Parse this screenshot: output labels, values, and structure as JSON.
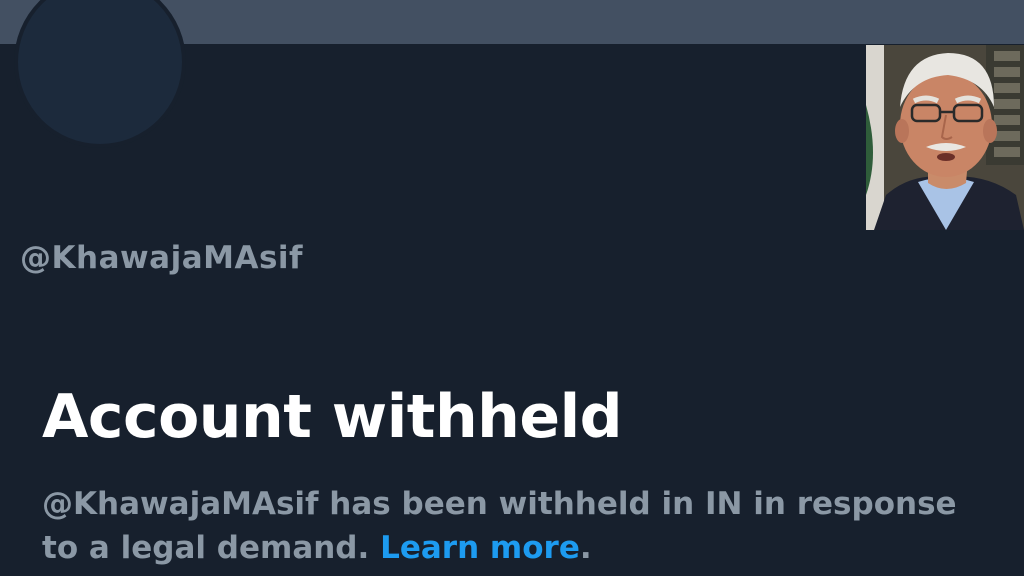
{
  "profile": {
    "handle": "@KhawajaMAsif"
  },
  "withheld_notice": {
    "title": "Account withheld",
    "message_line1": "@KhawajaMAsif has been withheld in IN in response",
    "message_line2": "to a legal demand. ",
    "link_label": "Learn more",
    "trailing": "."
  },
  "colors": {
    "background": "#17202d",
    "banner": "#435062",
    "muted_text": "#8b98a5",
    "link": "#1d9bf0",
    "title": "#ffffff"
  },
  "icons": {
    "inset": "person-photo"
  }
}
